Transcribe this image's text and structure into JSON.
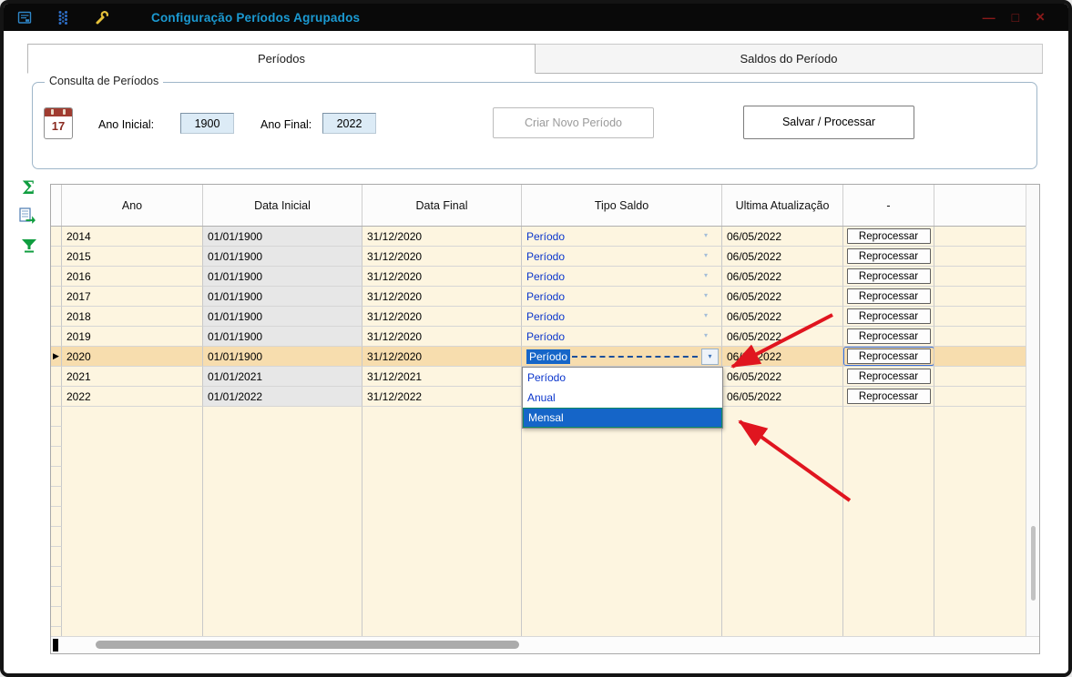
{
  "window": {
    "title": "Configuração Períodos Agrupados",
    "minimize": "—",
    "maximize": "□",
    "close": "×"
  },
  "tabs": {
    "periodos": "Períodos",
    "saldos": "Saldos do Período"
  },
  "consulta": {
    "title": "Consulta de Períodos",
    "calendar_day": "17",
    "ano_inicial_label": "Ano Inicial:",
    "ano_inicial_value": "1900",
    "ano_final_label": "Ano Final:",
    "ano_final_value": "2022",
    "criar_novo_periodo": "Criar Novo Período",
    "salvar_processar": "Salvar / Processar"
  },
  "icons": {
    "sigma": "Σ"
  },
  "grid": {
    "columns": {
      "ano": "Ano",
      "data_inicial": "Data Inicial",
      "data_final": "Data Final",
      "tipo_saldo": "Tipo Saldo",
      "ultima_atualizacao": "Ultima Atualização",
      "actions": "-"
    },
    "action_button": "Reprocessar",
    "rows": [
      {
        "ano": "2014",
        "data_inicial": "01/01/1900",
        "data_final": "31/12/2020",
        "tipo_saldo": "Período",
        "ultima_atualizacao": "06/05/2022",
        "selected": false
      },
      {
        "ano": "2015",
        "data_inicial": "01/01/1900",
        "data_final": "31/12/2020",
        "tipo_saldo": "Período",
        "ultima_atualizacao": "06/05/2022",
        "selected": false
      },
      {
        "ano": "2016",
        "data_inicial": "01/01/1900",
        "data_final": "31/12/2020",
        "tipo_saldo": "Período",
        "ultima_atualizacao": "06/05/2022",
        "selected": false
      },
      {
        "ano": "2017",
        "data_inicial": "01/01/1900",
        "data_final": "31/12/2020",
        "tipo_saldo": "Período",
        "ultima_atualizacao": "06/05/2022",
        "selected": false
      },
      {
        "ano": "2018",
        "data_inicial": "01/01/1900",
        "data_final": "31/12/2020",
        "tipo_saldo": "Período",
        "ultima_atualizacao": "06/05/2022",
        "selected": false
      },
      {
        "ano": "2019",
        "data_inicial": "01/01/1900",
        "data_final": "31/12/2020",
        "tipo_saldo": "Período",
        "ultima_atualizacao": "06/05/2022",
        "selected": false
      },
      {
        "ano": "2020",
        "data_inicial": "01/01/1900",
        "data_final": "31/12/2020",
        "tipo_saldo": "Período",
        "ultima_atualizacao": "06/05/2022",
        "selected": true
      },
      {
        "ano": "2021",
        "data_inicial": "01/01/2021",
        "data_final": "31/12/2021",
        "tipo_saldo": "",
        "ultima_atualizacao": "06/05/2022",
        "selected": false
      },
      {
        "ano": "2022",
        "data_inicial": "01/01/2022",
        "data_final": "31/12/2022",
        "tipo_saldo": "",
        "ultima_atualizacao": "06/05/2022",
        "selected": false
      }
    ]
  },
  "dropdown": {
    "options": [
      {
        "label": "Período",
        "highlighted": false
      },
      {
        "label": "Anual",
        "highlighted": false
      },
      {
        "label": "Mensal",
        "highlighted": true
      }
    ]
  },
  "colors": {
    "title_blue": "#1b9ad2",
    "combo_text_blue": "#0a35cc",
    "selection_blue": "#1565c8",
    "row_beige": "#fdf5e0",
    "row_selected_orange": "#f7ddae",
    "readonly_gray": "#e7e7e7",
    "annotation_red": "#e0151f",
    "icon_green": "#0f9d3f",
    "control_red": "#8b1a1a"
  }
}
